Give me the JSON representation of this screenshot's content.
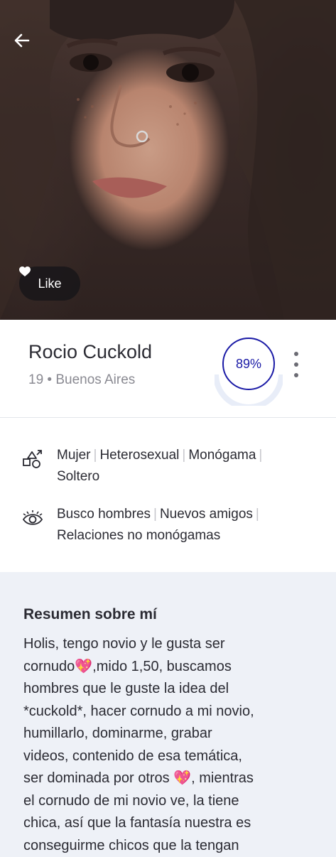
{
  "profile_photo": {
    "alt": "profile-photo"
  },
  "actions": {
    "like_label": "Like"
  },
  "profile": {
    "name": "Rocio Cuckold",
    "age_location": "19 • Buenos Aires",
    "match_percent": "89%"
  },
  "details": {
    "identity": [
      "Mujer",
      "Heterosexual",
      "Monógama",
      "Soltero"
    ],
    "looking_for": [
      "Busco hombres",
      "Nuevos amigos",
      "Relaciones no monógamas"
    ]
  },
  "about": {
    "title": "Resumen sobre mí",
    "body": "Holis, tengo novio y le gusta ser\ncornudo💖,mido 1,50, buscamos\nhombres que le guste la idea del\n*cuckold*, hacer cornudo a mi novio,\nhumillarlo, dominarme, grabar\nvideos, contenido de esa temática,\nser dominada por otros 💖, mientras\nel cornudo de mi novio ve, la tiene\nchica, así que la fantasía nuestra es\nconseguirme chicos que la tengan"
  },
  "icons": {
    "back": "arrow-left-icon",
    "like": "heart-icon",
    "more": "more-vertical-icon",
    "identity": "shapes-icon",
    "looking_for": "eye-icon"
  },
  "colors": {
    "match_ring": "#1a1aa6",
    "about_bg": "#eef1f7"
  }
}
